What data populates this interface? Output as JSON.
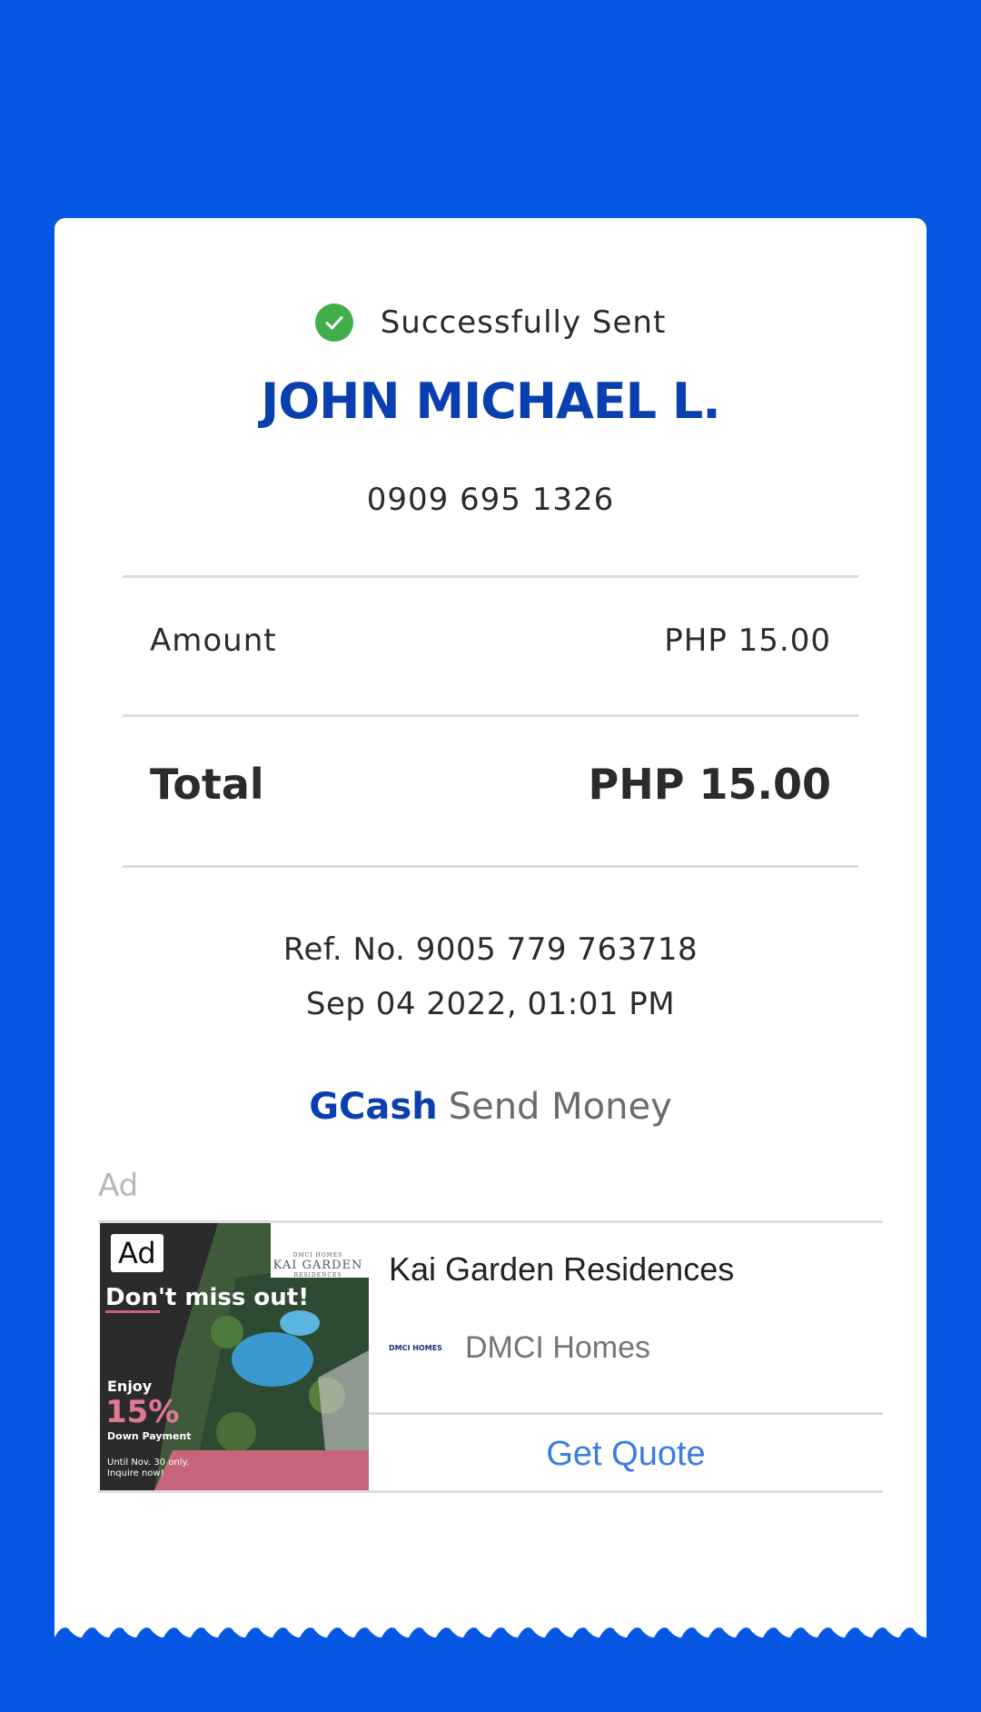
{
  "status": {
    "text": "Successfully Sent",
    "icon": "check-circle-icon",
    "icon_color": "#3fae4b"
  },
  "recipient": {
    "name": "JOHN MICHAEL L.",
    "number": "0909 695 1326"
  },
  "amount": {
    "label": "Amount",
    "value": "PHP 15.00"
  },
  "total": {
    "label": "Total",
    "value": "PHP 15.00"
  },
  "reference": {
    "ref_no": "Ref. No. 9005 779 763718",
    "datetime": "Sep 04 2022, 01:01 PM"
  },
  "service": {
    "brand": "GCash",
    "name": "Send Money"
  },
  "ad": {
    "label": "Ad",
    "badge": "Ad",
    "image_headline": "Don't miss out!",
    "image_logo_small": "DMCI HOMES",
    "image_logo": "KAI GARDEN",
    "image_logo_sub": "RESIDENCES",
    "image_enjoy": "Enjoy",
    "image_percent": "15%",
    "image_down_payment": "Down Payment",
    "image_until": "Until Nov. 30 only.",
    "image_inquire": "Inquire now!",
    "title": "Kai Garden Residences",
    "advertiser_logo": "DMCI HOMES",
    "advertiser": "DMCI Homes",
    "cta": "Get Quote"
  },
  "colors": {
    "background": "#0757e5",
    "brand_blue": "#0a3fb0",
    "cta_blue": "#3a7de0"
  }
}
